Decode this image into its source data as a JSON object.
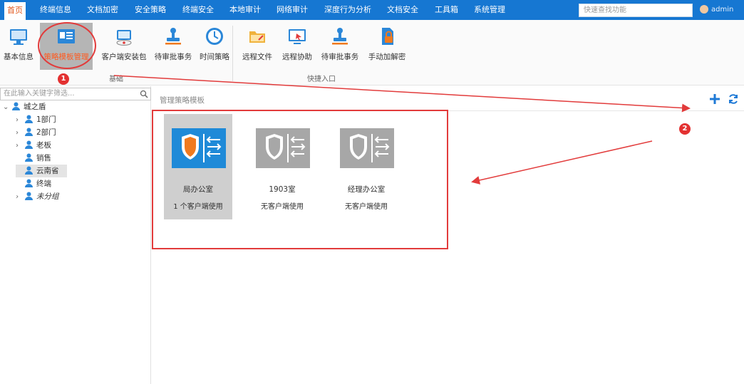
{
  "nav": {
    "tabs": [
      {
        "label": "首页",
        "active": true
      },
      {
        "label": "终端信息"
      },
      {
        "label": "文档加密"
      },
      {
        "label": "安全策略"
      },
      {
        "label": "终端安全"
      },
      {
        "label": "本地审计"
      },
      {
        "label": "网络审计"
      },
      {
        "label": "深度行为分析"
      },
      {
        "label": "文档安全"
      },
      {
        "label": "工具箱"
      },
      {
        "label": "系统管理"
      }
    ],
    "search_placeholder": "快速查找功能",
    "user": "admin"
  },
  "ribbon": {
    "basic_group_label": "基础",
    "quick_group_label": "快捷入口",
    "buttons": [
      {
        "label": "基本信息",
        "icon": "monitor-icon"
      },
      {
        "label": "策略模板管理",
        "icon": "template-card-icon",
        "selected": true
      },
      {
        "label": "客户端安装包",
        "icon": "install-package-icon"
      },
      {
        "label": "待审批事务",
        "icon": "stamp-icon"
      },
      {
        "label": "时间策略",
        "icon": "clock-icon"
      },
      {
        "label": "远程文件",
        "icon": "folder-icon"
      },
      {
        "label": "远程协助",
        "icon": "remote-screen-icon"
      },
      {
        "label": "待审批事务",
        "icon": "stamp-icon"
      },
      {
        "label": "手动加解密",
        "icon": "lock-document-icon"
      }
    ]
  },
  "tree": {
    "filter_placeholder": "在此输入关键字筛选...",
    "root": "城之盾",
    "items": [
      {
        "label": "1部门",
        "expandable": true
      },
      {
        "label": "2部门",
        "expandable": true
      },
      {
        "label": "老板",
        "expandable": true
      },
      {
        "label": "销售",
        "expandable": false
      },
      {
        "label": "云南省",
        "expandable": false,
        "selected": true
      },
      {
        "label": "终端",
        "expandable": false
      },
      {
        "label": "未分组",
        "expandable": true
      }
    ]
  },
  "content": {
    "title": "管理策略模板",
    "templates": [
      {
        "name": "局办公室",
        "usage": "1 个客户端使用",
        "selected": true
      },
      {
        "name": "1903室",
        "usage": "无客户端使用"
      },
      {
        "name": "经理办公室",
        "usage": "无客户端使用"
      }
    ]
  },
  "annotations": {
    "badge1": "1",
    "badge2": "2",
    "color": "#e23b3b"
  },
  "colors": {
    "nav_bg": "#1677d2",
    "accent_orange": "#ff5a1f",
    "shield_blue": "#1f8ad8",
    "shield_orange": "#f07a1f",
    "grey_template": "#a7a7a7"
  }
}
